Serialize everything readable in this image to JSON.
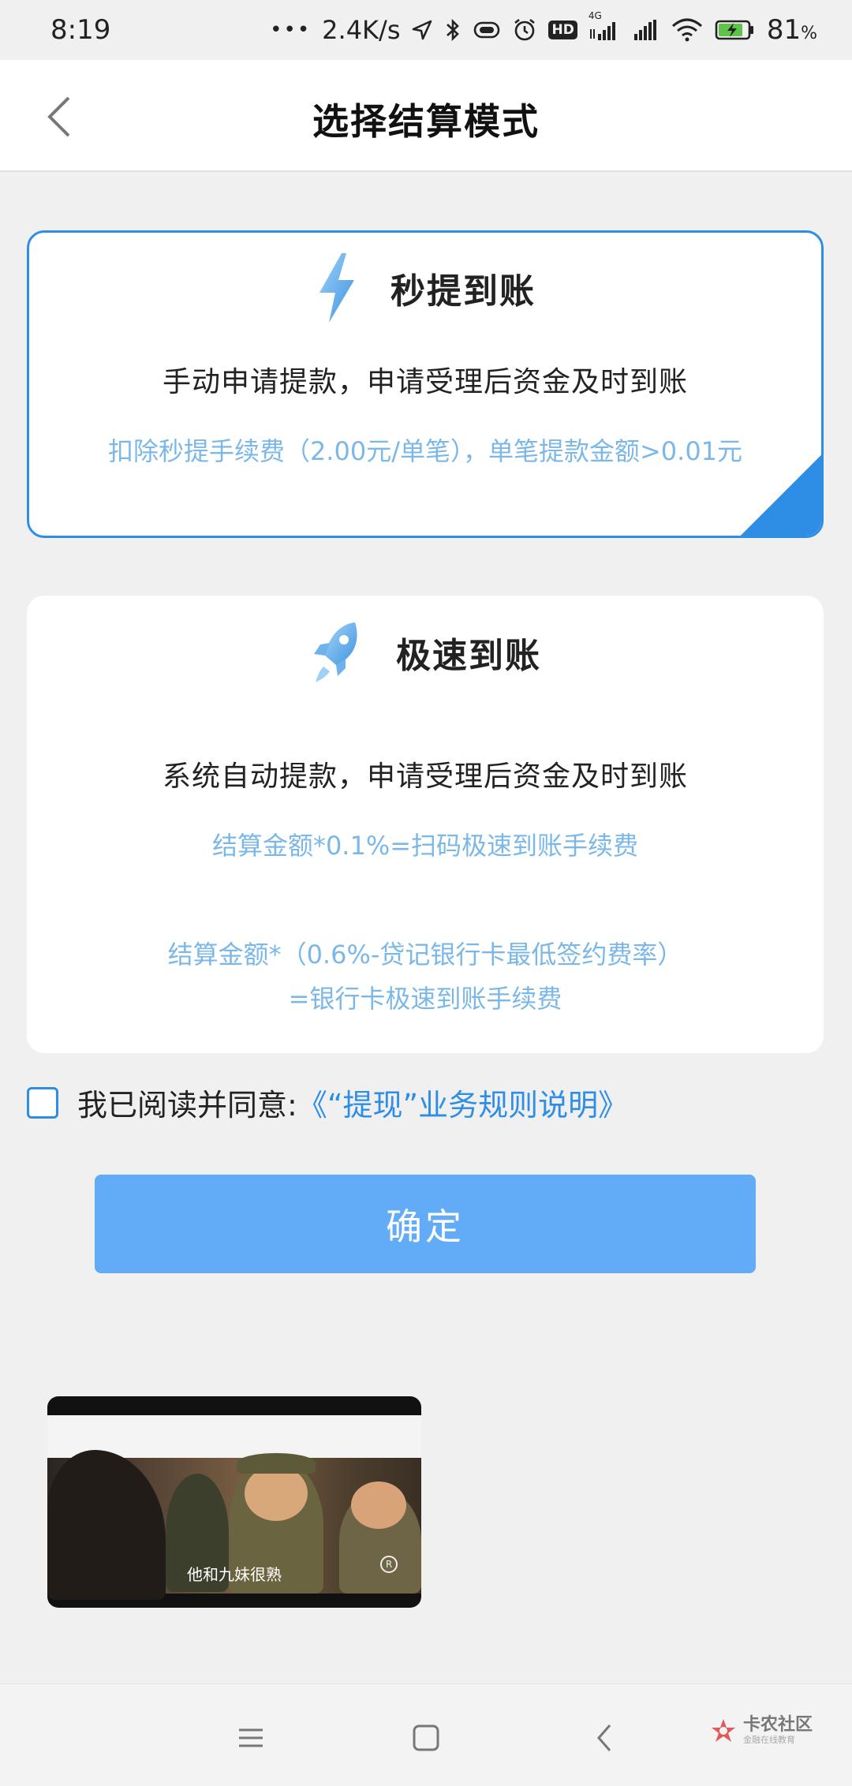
{
  "status_bar": {
    "time": "8:19",
    "network_speed": "2.4K/s",
    "hd": "HD",
    "signal_type": "4G",
    "battery": "81",
    "battery_unit": "%"
  },
  "header": {
    "title": "选择结算模式",
    "back_icon": "chevron-left-icon"
  },
  "options": [
    {
      "icon": "lightning-icon",
      "title": "秒提到账",
      "description": "手动申请提款，申请受理后资金及时到账",
      "notes": [
        "扣除秒提手续费（2.00元/单笔），单笔提款金额>0.01元"
      ],
      "selected": true
    },
    {
      "icon": "rocket-icon",
      "title": "极速到账",
      "description": "系统自动提款，申请受理后资金及时到账",
      "notes": [
        "结算金额*0.1%=扫码极速到账手续费",
        "结算金额*（0.6%-贷记银行卡最低签约费率）",
        "=银行卡极速到账手续费"
      ],
      "selected": false
    }
  ],
  "agreement": {
    "checked": false,
    "text": "我已阅读并同意:",
    "link": "《“提现”业务规则说明》"
  },
  "confirm_label": "确定",
  "video": {
    "subtitle": "他和九妹很熟",
    "mark": "R"
  },
  "nav": {
    "menu_icon": "menu-icon",
    "home_icon": "square-home-icon",
    "back_icon": "back-triangle-icon"
  },
  "brand": {
    "name": "卡农社区",
    "tagline": "金融在线教育"
  },
  "colors": {
    "accent": "#2e8ee6",
    "note_text": "#7bb8e8",
    "confirm_bg": "#62abf6",
    "background": "#f0f0f0"
  }
}
